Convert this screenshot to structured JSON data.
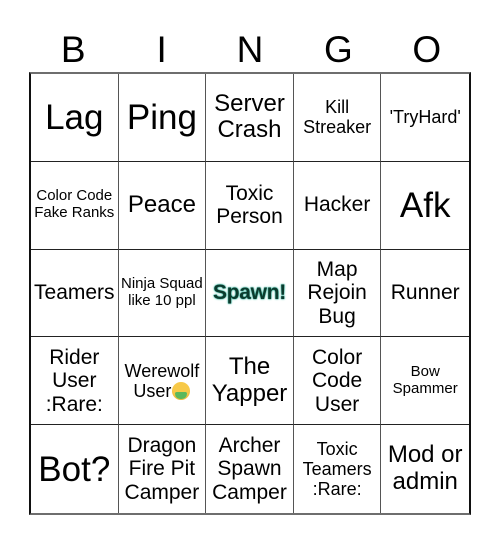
{
  "header": {
    "letters": [
      "B",
      "I",
      "N",
      "G",
      "O"
    ]
  },
  "cells": [
    {
      "text": "Lag",
      "size": "xl"
    },
    {
      "text": "Ping",
      "size": "xl"
    },
    {
      "text": "Server Crash",
      "size": "l"
    },
    {
      "text": "Kill Streaker",
      "size": "s"
    },
    {
      "text": "'TryHard'",
      "size": "s"
    },
    {
      "text": "Color Code Fake Ranks",
      "size": "xs"
    },
    {
      "text": "Peace",
      "size": "l"
    },
    {
      "text": "Toxic Person",
      "size": "m"
    },
    {
      "text": "Hacker",
      "size": "m"
    },
    {
      "text": "Afk",
      "size": "xl"
    },
    {
      "text": "Teamers",
      "size": "m"
    },
    {
      "text": "Ninja Squad like 10 ppl",
      "size": "xs"
    },
    {
      "text": "Spawn!",
      "size": "free",
      "free_space": true
    },
    {
      "text": "Map Rejoin Bug",
      "size": "m"
    },
    {
      "text": "Runner",
      "size": "m"
    },
    {
      "text": "Rider User :Rare:",
      "size": "m"
    },
    {
      "text": "Werewolf User",
      "size": "s",
      "emoji": "face-vomiting"
    },
    {
      "text": "The Yapper",
      "size": "l"
    },
    {
      "text": "Color Code User",
      "size": "m"
    },
    {
      "text": "Bow Spammer",
      "size": "xs"
    },
    {
      "text": "Bot?",
      "size": "xl"
    },
    {
      "text": "Dragon Fire Pit Camper",
      "size": "m"
    },
    {
      "text": "Archer Spawn Camper",
      "size": "m"
    },
    {
      "text": "Toxic Teamers :Rare:",
      "size": "s"
    },
    {
      "text": "Mod or admin",
      "size": "l"
    }
  ],
  "colors": {
    "free_space_fill": "#0c3a2d",
    "free_space_glow": "#3fb5a0",
    "grid_line": "#333333"
  }
}
